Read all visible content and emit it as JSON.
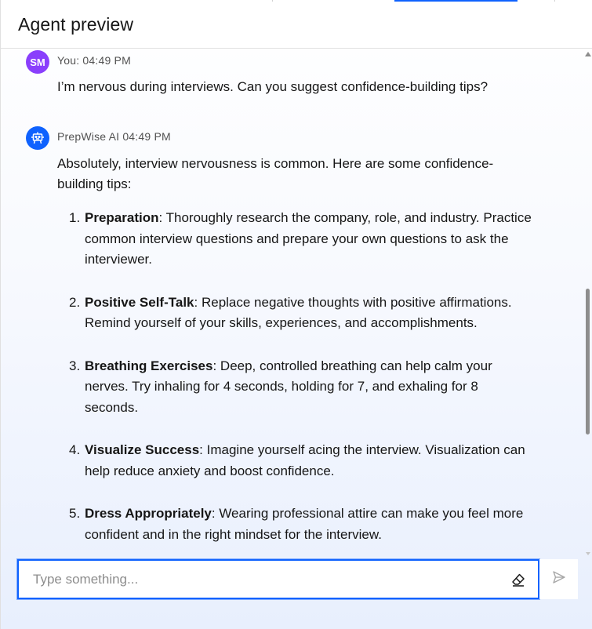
{
  "header": {
    "title": "Agent preview"
  },
  "messages": [
    {
      "author_initials": "SM",
      "meta": "You: 04:49 PM",
      "text": "I’m nervous during interviews. Can you suggest confidence-building tips?"
    },
    {
      "meta": "PrepWise AI 04:49 PM",
      "intro_line1": "Absolutely, interview nervousness is common. Here are some confidence-",
      "intro_line2": "building tips:",
      "tips": [
        {
          "num": "1.",
          "title": "Preparation",
          "body": ": Thoroughly research the company, role, and industry. Practice common interview questions and prepare your own questions to ask the interviewer."
        },
        {
          "num": "2.",
          "title": "Positive Self-Talk",
          "body": ": Replace negative thoughts with positive affirmations. Remind yourself of your skills, experiences, and accomplishments."
        },
        {
          "num": "3.",
          "title": "Breathing Exercises",
          "body": ": Deep, controlled breathing can help calm your nerves. Try inhaling for 4 seconds, holding for 7, and exhaling for 8 seconds."
        },
        {
          "num": "4.",
          "title": "Visualize Success",
          "body": ": Imagine yourself acing the interview. Visualization can help reduce anxiety and boost confidence."
        },
        {
          "num": "5.",
          "title": "Dress Appropriately",
          "body": ": Wearing professional attire can make you feel more confident and in the right mindset for the interview."
        }
      ]
    }
  ],
  "composer": {
    "placeholder": "Type something...",
    "value": ""
  },
  "icons": {
    "bot_avatar": "robot-icon",
    "clear": "eraser-icon",
    "send": "send-icon"
  },
  "colors": {
    "accent": "#0f62fe",
    "user_avatar": "#8a3ffc",
    "bot_avatar": "#0f62fe"
  }
}
